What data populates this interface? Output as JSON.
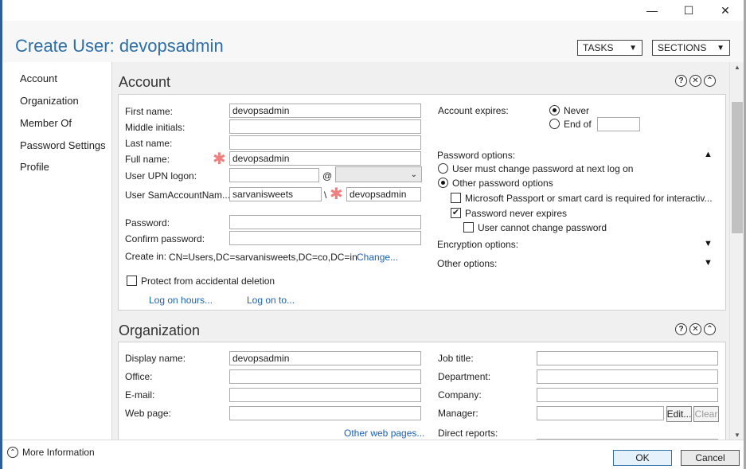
{
  "window": {
    "title": "Create User: devopsadmin",
    "minimize_glyph": "—",
    "maximize_glyph": "☐",
    "close_glyph": "✕"
  },
  "header": {
    "tasks_label": "TASKS",
    "sections_label": "SECTIONS",
    "dropdown_glyph": "▼"
  },
  "nav": {
    "items": [
      "Account",
      "Organization",
      "Member Of",
      "Password Settings",
      "Profile"
    ]
  },
  "section_controls": {
    "help": "?",
    "close": "✕",
    "collapse": "⌃"
  },
  "account": {
    "title": "Account",
    "first_name_label": "First name:",
    "first_name_value": "devopsadmin",
    "middle_initials_label": "Middle initials:",
    "middle_initials_value": "",
    "last_name_label": "Last name:",
    "last_name_value": "",
    "full_name_label": "Full name:",
    "full_name_value": "devopsadmin",
    "upn_label": "User UPN logon:",
    "upn_value": "",
    "upn_at": "@",
    "upn_domain_value": "",
    "sam_label": "User SamAccountNam...",
    "sam_domain_value": "sarvanisweets",
    "sam_separator": "\\",
    "sam_value": "devopsadmin",
    "password_label": "Password:",
    "confirm_password_label": "Confirm password:",
    "create_in_label": "Create in:",
    "create_in_value": "CN=Users,DC=sarvanisweets,DC=co,DC=in",
    "change_link": "Change...",
    "protect_label": "Protect from accidental deletion",
    "log_on_hours_link": "Log on hours...",
    "log_on_to_link": "Log on to...",
    "required_glyph": "✱",
    "account_expires_label": "Account expires:",
    "never_label": "Never",
    "end_of_label": "End of",
    "end_of_value": "",
    "password_options_label": "Password options:",
    "must_change_label": "User must change password at next log on",
    "other_options_label": "Other password options",
    "passport_label": "Microsoft Passport or smart card is required for interactiv...",
    "never_expires_label": "Password never expires",
    "cannot_change_label": "User cannot change password",
    "encryption_label": "Encryption options:",
    "other_label": "Other options:",
    "expand_up_glyph": "▲",
    "expand_down_glyph": "▼",
    "check_glyph": "✔"
  },
  "organization": {
    "title": "Organization",
    "display_name_label": "Display name:",
    "display_name_value": "devopsadmin",
    "office_label": "Office:",
    "email_label": "E-mail:",
    "web_page_label": "Web page:",
    "other_web_pages_link": "Other web pages...",
    "job_title_label": "Job title:",
    "department_label": "Department:",
    "company_label": "Company:",
    "manager_label": "Manager:",
    "edit_label": "Edit...",
    "clear_label": "Clear",
    "direct_reports_label": "Direct reports:"
  },
  "footer": {
    "more_info_label": "More Information",
    "ok_label": "OK",
    "cancel_label": "Cancel"
  }
}
